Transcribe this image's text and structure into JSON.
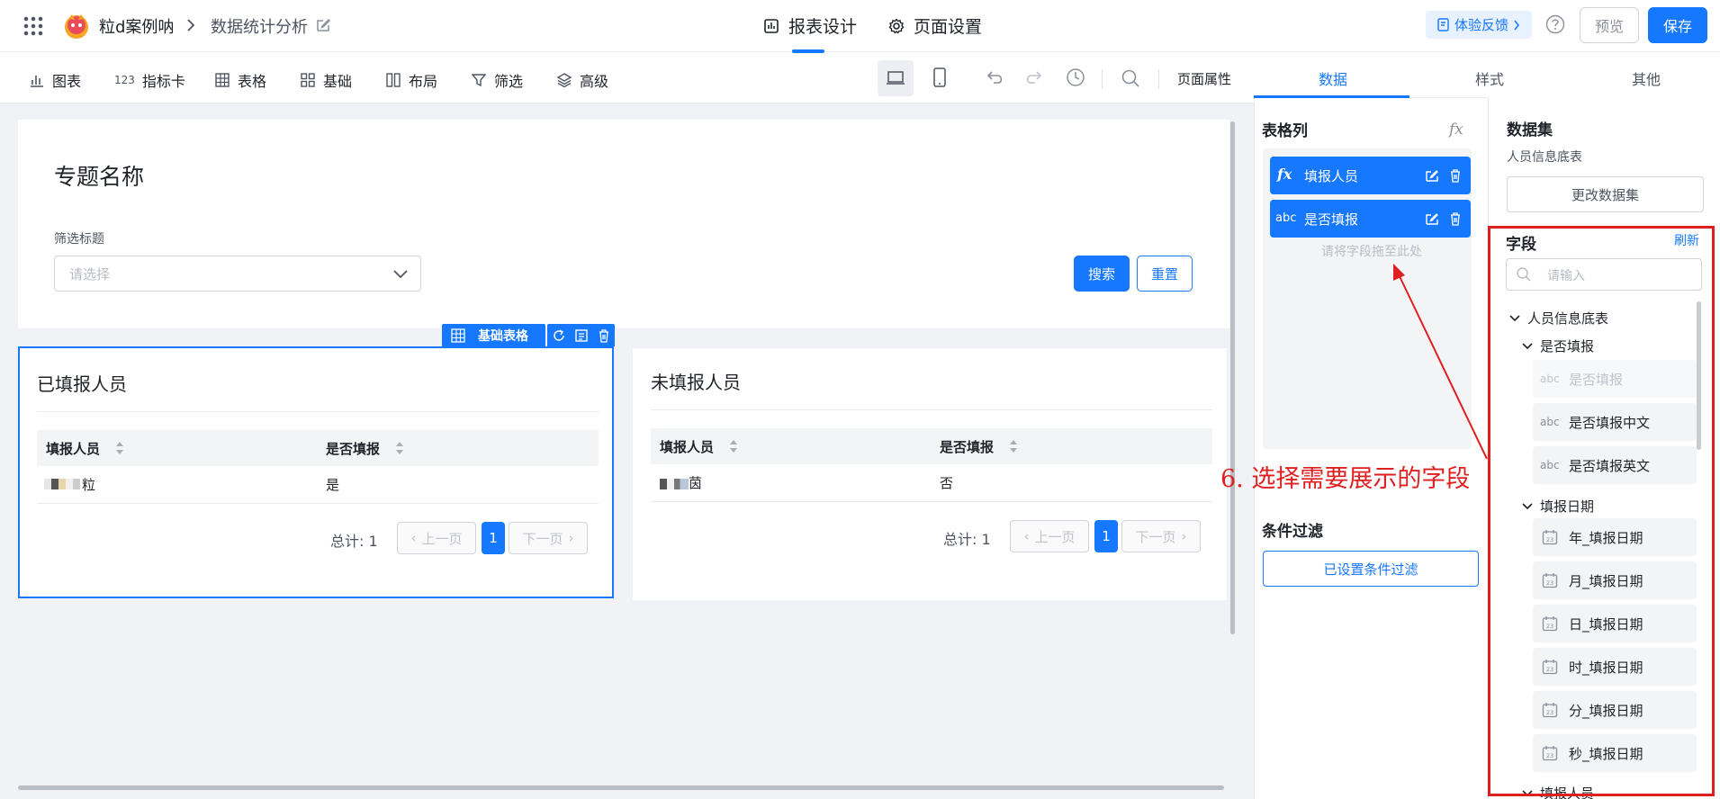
{
  "header": {
    "app_name": "粒d案例呐",
    "page_name": "数据统计分析",
    "tabs": [
      {
        "label": "报表设计",
        "active": true
      },
      {
        "label": "页面设置",
        "active": false
      }
    ],
    "feedback_label": "体验反馈",
    "preview_label": "预览",
    "save_label": "保存"
  },
  "toolbar": {
    "items": [
      {
        "label": "图表",
        "icon": "bar-chart-icon"
      },
      {
        "label": "指标卡",
        "icon": "metric-card-icon"
      },
      {
        "label": "表格",
        "icon": "table-icon"
      },
      {
        "label": "基础",
        "icon": "grid-icon"
      },
      {
        "label": "布局",
        "icon": "layout-icon"
      },
      {
        "label": "筛选",
        "icon": "filter-icon"
      },
      {
        "label": "高级",
        "icon": "layers-icon"
      }
    ],
    "page_props_label": "页面属性"
  },
  "canvas": {
    "topic_title": "专题名称",
    "filter_label": "筛选标题",
    "filter_placeholder": "请选择",
    "search_label": "搜索",
    "reset_label": "重置",
    "selection_badge": "基础表格",
    "tables": [
      {
        "title": "已填报人员",
        "columns": [
          "填报人员",
          "是否填报"
        ],
        "rows": [
          [
            "粒",
            "是"
          ]
        ],
        "total_label": "总计: 1",
        "prev_label": "上一页",
        "next_label": "下一页",
        "page": "1"
      },
      {
        "title": "未填报人员",
        "columns": [
          "填报人员",
          "是否填报"
        ],
        "rows": [
          [
            "茵",
            "否"
          ]
        ],
        "total_label": "总计: 1",
        "prev_label": "上一页",
        "next_label": "下一页",
        "page": "1"
      }
    ]
  },
  "annotation": "6. 选择需要展示的字段",
  "right_tabs": [
    "数据",
    "样式",
    "其他"
  ],
  "columns_panel": {
    "title": "表格列",
    "fx_label": "fx",
    "columns": [
      {
        "type_label": "fx",
        "name": "填报人员"
      },
      {
        "type_label": "abc",
        "name": "是否填报"
      }
    ],
    "drop_hint": "请将字段拖至此处",
    "filter_title": "条件过滤",
    "filter_button": "已设置条件过滤"
  },
  "dataset_panel": {
    "title": "数据集",
    "dataset_name": "人员信息底表",
    "change_button": "更改数据集",
    "fields_title": "字段",
    "refresh_label": "刷新",
    "search_placeholder": "请输入",
    "tree_root": "人员信息底表",
    "groups": [
      {
        "label": "是否填报",
        "items": [
          {
            "type": "abc",
            "label": "是否填报",
            "disabled": true
          },
          {
            "type": "abc",
            "label": "是否填报中文",
            "disabled": false
          },
          {
            "type": "abc",
            "label": "是否填报英文",
            "disabled": false
          }
        ]
      },
      {
        "label": "填报日期",
        "items": [
          {
            "type": "date",
            "label": "年_填报日期"
          },
          {
            "type": "date",
            "label": "月_填报日期"
          },
          {
            "type": "date",
            "label": "日_填报日期"
          },
          {
            "type": "date",
            "label": "时_填报日期"
          },
          {
            "type": "date",
            "label": "分_填报日期"
          },
          {
            "type": "date",
            "label": "秒_填报日期"
          }
        ]
      },
      {
        "label": "填报人员",
        "items": []
      }
    ]
  },
  "colors": {
    "primary": "#1677ff",
    "annotation_red": "#e02020",
    "canvas_bg": "#f0f2f5"
  }
}
